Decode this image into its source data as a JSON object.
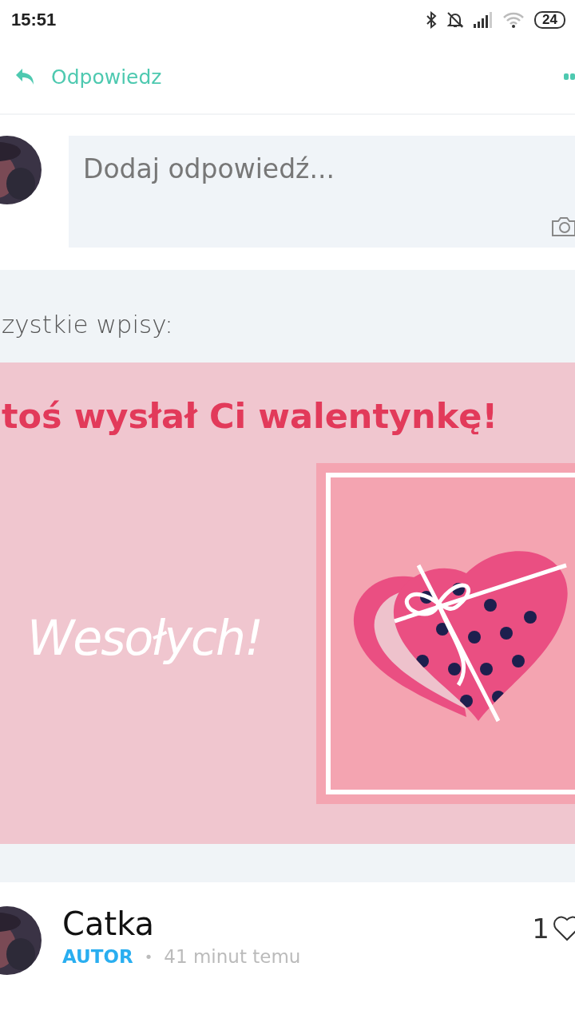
{
  "status_bar": {
    "time": "15:51",
    "battery": "24"
  },
  "header": {
    "reply_label": "Odpowiedz"
  },
  "reply_box": {
    "placeholder": "Dodaj odpowiedź..."
  },
  "feed": {
    "heading": "zystkie wpisy:"
  },
  "post": {
    "title": "toś wysłał Ci walentynkę!",
    "greeting": "Wesołych!",
    "author": "Catka",
    "role": "AUTOR",
    "separator": "•",
    "time": "41 minut temu",
    "likes": "1"
  }
}
